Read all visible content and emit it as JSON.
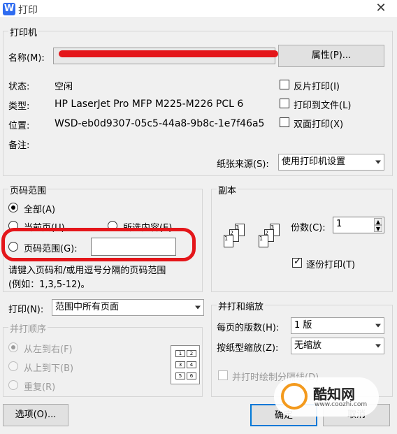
{
  "window": {
    "title": "打印",
    "app_icon_letter": "W"
  },
  "printer": {
    "group_title": "打印机",
    "name_label": "名称(M):",
    "name_value": "",
    "properties_button": "属性(P)...",
    "status_label": "状态:",
    "status_value": "空闲",
    "type_label": "类型:",
    "type_value": "HP LaserJet Pro MFP M225-M226 PCL 6",
    "location_label": "位置:",
    "location_value": "WSD-eb0d9307-05c5-44a8-9b8c-1e7f46a5",
    "comment_label": "备注:",
    "reverse_print": "反片打印(I)",
    "print_to_file": "打印到文件(L)",
    "duplex_print": "双面打印(X)",
    "paper_source_label": "纸张来源(S):",
    "paper_source_value": "使用打印机设置"
  },
  "page_range": {
    "group_title": "页码范围",
    "all": "全部(A)",
    "current": "当前页(U)",
    "selection": "所选内容(E)",
    "pages": "页码范围(G):",
    "pages_value": "",
    "hint_line1": "请键入页码和/或用逗号分隔的页码范围",
    "hint_line2": "(例如：1,3,5-12)。"
  },
  "copies": {
    "group_title": "副本",
    "count_label": "份数(C):",
    "count_value": "1",
    "collate": "逐份打印(T)"
  },
  "print_what": {
    "label": "打印(N):",
    "value": "范围中所有页面"
  },
  "print_order": {
    "group_title": "并打顺序",
    "left_to_right": "从左到右(F)",
    "top_to_bottom": "从上到下(B)",
    "repeat": "重复(R)",
    "grid": [
      "1",
      "2",
      "3",
      "4",
      "5",
      "6"
    ]
  },
  "zoom": {
    "group_title": "并打和缩放",
    "pages_per_sheet_label": "每页的版数(H):",
    "pages_per_sheet_value": "1 版",
    "scale_label": "按纸型缩放(Z):",
    "scale_value": "无缩放",
    "draw_borders": "并打时绘制分隔线(D)"
  },
  "footer": {
    "options": "选项(O)...",
    "ok": "确定",
    "cancel": "取消"
  },
  "watermark": {
    "name": "酷知网",
    "url": "www.coozhi.com"
  }
}
